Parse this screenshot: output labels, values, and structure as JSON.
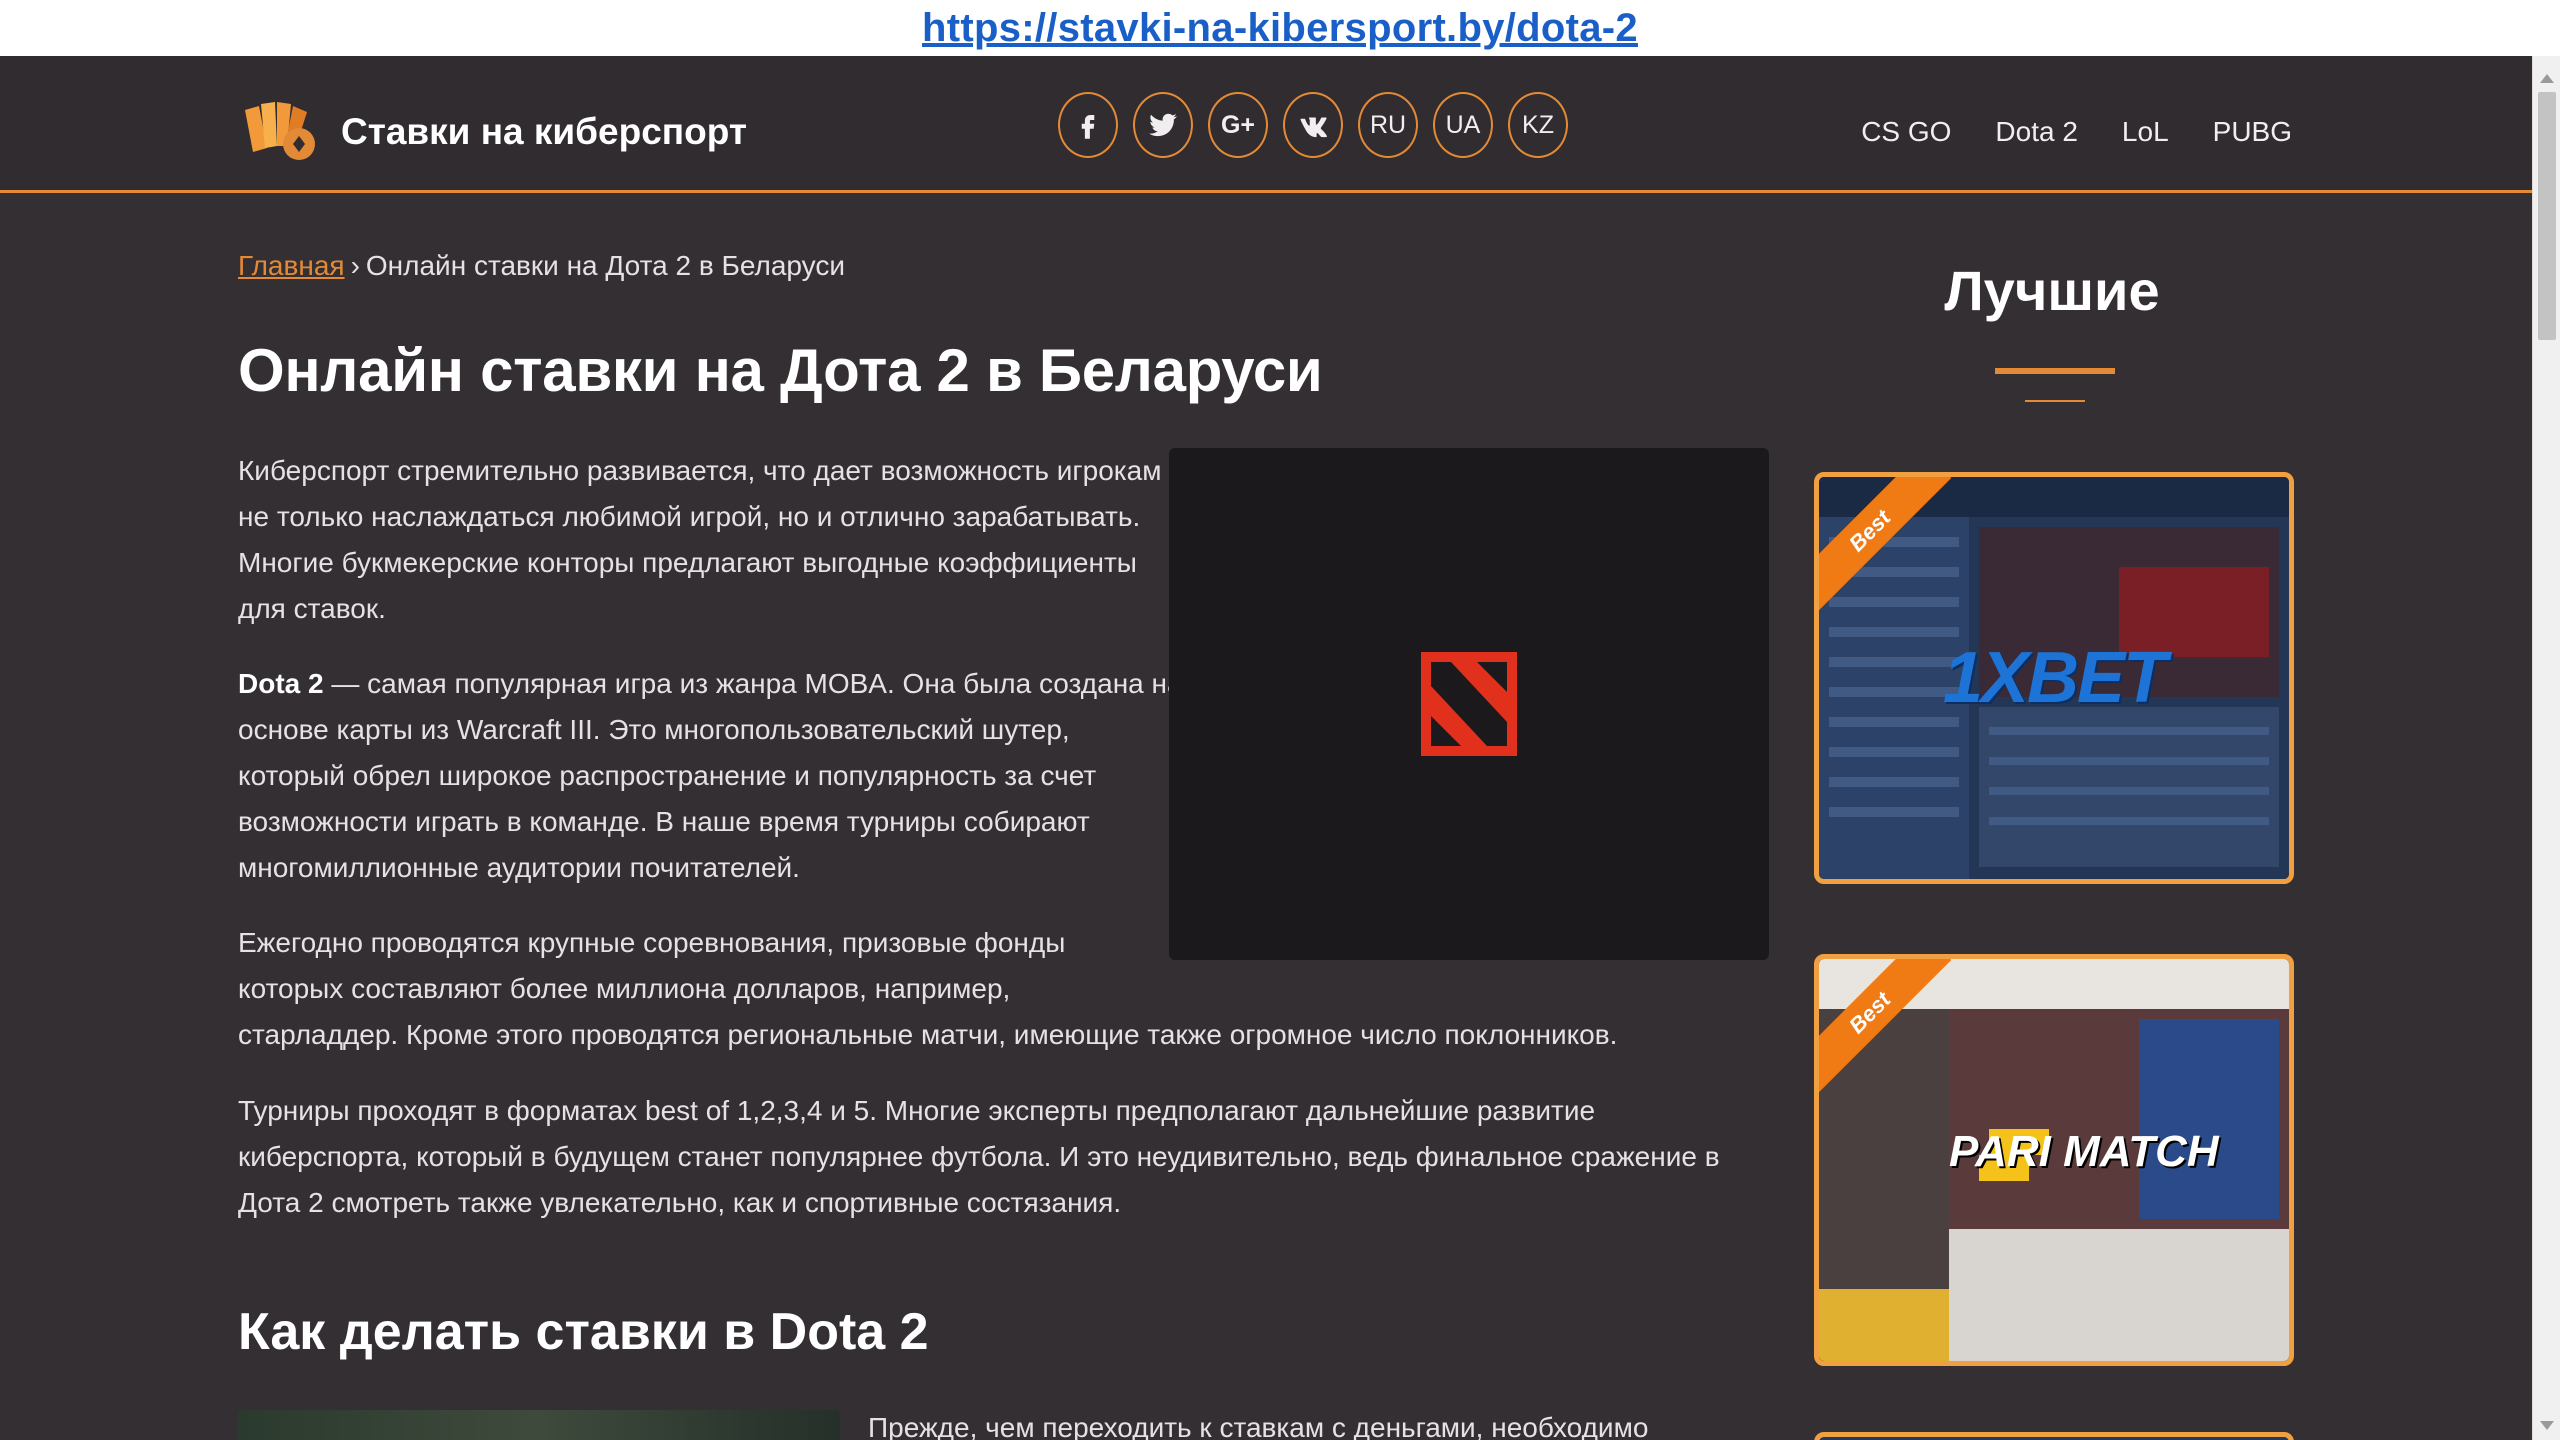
{
  "url_caption": "https://stavki-na-kibersport.by/dota-2",
  "header": {
    "site_name": "Ставки на киберспорт",
    "social": [
      {
        "icon": "facebook-icon",
        "label": "f"
      },
      {
        "icon": "twitter-icon",
        "label": ""
      },
      {
        "icon": "google-plus-icon",
        "label": "G+"
      },
      {
        "icon": "vk-icon",
        "label": "vk"
      }
    ],
    "languages": [
      "RU",
      "UA",
      "KZ"
    ],
    "nav": [
      "CS GO",
      "Dota 2",
      "LoL",
      "PUBG"
    ]
  },
  "breadcrumb": {
    "home": "Главная",
    "separator": "›",
    "current": "Онлайн ставки на Дота 2 в Беларуси"
  },
  "main": {
    "title": "Онлайн ставки на Дота 2 в Беларуси",
    "p1": "Киберспорт стремительно развивается, что дает возможность игрокам не только наслаждаться любимой игрой, но и отлично зарабатывать. Многие букмекерские конторы предлагают выгодные коэффициенты для ставок.",
    "p2_bold": "Dota 2",
    "p2_rest": " — самая популярная игра из жанра MOBA. Она была создана на основе карты из Warcraft III. Это многопользовательский шутер, который обрел широкое распространение и популярность за счет возможности играть в команде. В наше время турниры собирают многомиллионные аудитории почитателей.",
    "p3_line1": "Ежегодно проводятся крупные соревнования, призовые фонды",
    "p3_line2": "которых составляют более миллиона долларов, например,",
    "p3_line3": "старладдер. Кроме этого проводятся региональные матчи, имеющие также огромное число поклонников.",
    "p4": "Турниры проходят в форматах best of 1,2,3,4 и 5. Многие эксперты предполагают дальнейшие развитие киберспорта, который в будущем станет популярнее футбола. И это неудивительно, ведь финальное сражение в Дота 2 смотреть также увлекательно, как и спортивные состязания.",
    "section_title": "Как делать ставки в Dota 2",
    "p5_cut": "Прежде, чем переходить к ставкам с деньгами, необходимо"
  },
  "sidebar": {
    "title": "Лучшие",
    "cards": [
      {
        "badge": "Best",
        "brand": "1XBET"
      },
      {
        "badge": "Best",
        "brand": "PARI MATCH"
      }
    ]
  },
  "colors": {
    "accent": "#e38a36",
    "background": "#332f33",
    "header_bg": "#302c30",
    "card_border": "#f0a041",
    "dota_red": "#e1301b"
  }
}
